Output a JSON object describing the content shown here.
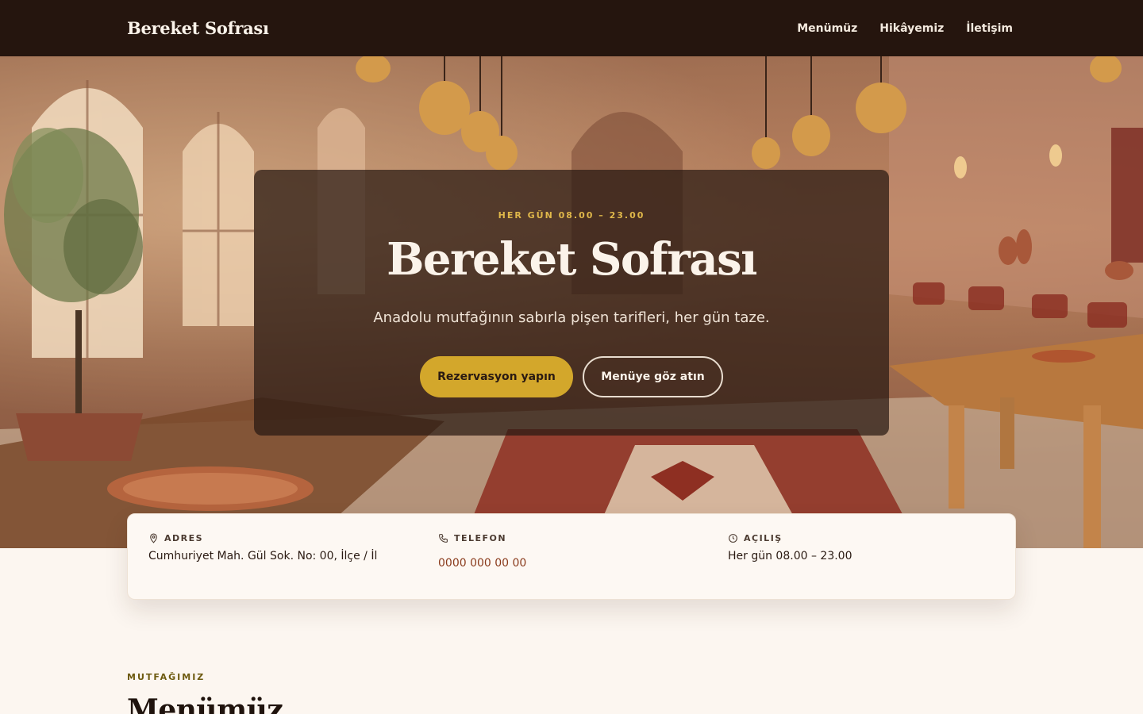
{
  "header": {
    "brand": "Bereket Sofrası",
    "nav": [
      "Menümüz",
      "Hikâyemiz",
      "İletişim"
    ]
  },
  "hero": {
    "kicker": "HER GÜN 08.00 – 23.00",
    "title": "Bereket Sofrası",
    "subtitle": "Anadolu mutfağının sabırla pişen tarifleri, her gün taze.",
    "primary_button": "Rezervasyon yapın",
    "secondary_button": "Menüye göz atın"
  },
  "info": {
    "address": {
      "label": "ADRES",
      "value": "Cumhuriyet Mah. Gül Sok. No: 00, İlçe / İl",
      "icon": "location-pin-icon"
    },
    "phone": {
      "label": "TELEFON",
      "value": "0000 000 00 00",
      "icon": "phone-icon"
    },
    "hours": {
      "label": "AÇILIŞ",
      "value": "Her gün 08.00 – 23.00",
      "icon": "clock-icon"
    }
  },
  "menu_section": {
    "kicker": "MUTFAĞIMIZ",
    "title": "Menümüz"
  },
  "colors": {
    "header_bg": "#25150e",
    "accent_gold": "#d3a72b",
    "page_bg": "#fcf6f0",
    "phone_link": "#8a3b1c"
  }
}
